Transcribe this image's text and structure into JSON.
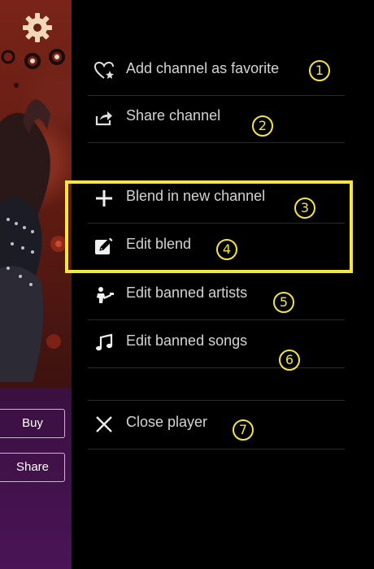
{
  "player": {
    "buy_label": "Buy",
    "share_label": "Share",
    "settings_icon": "gear-icon"
  },
  "menu": {
    "items": [
      {
        "label": "Add channel as favorite",
        "icon": "heart-star-icon",
        "badge": "1"
      },
      {
        "label": "Share channel",
        "icon": "share-icon",
        "badge": "2"
      },
      {
        "label": "Blend in new channel",
        "icon": "plus-icon",
        "badge": "3"
      },
      {
        "label": "Edit blend",
        "icon": "edit-icon",
        "badge": "4"
      },
      {
        "label": "Edit banned artists",
        "icon": "artist-icon",
        "badge": "5"
      },
      {
        "label": "Edit banned songs",
        "icon": "music-note-icon",
        "badge": "6"
      },
      {
        "label": "Close player",
        "icon": "close-icon",
        "badge": "7"
      }
    ]
  },
  "colors": {
    "badge": "#f4e640",
    "menu_text": "#d4d4d4",
    "background": "#000000"
  }
}
